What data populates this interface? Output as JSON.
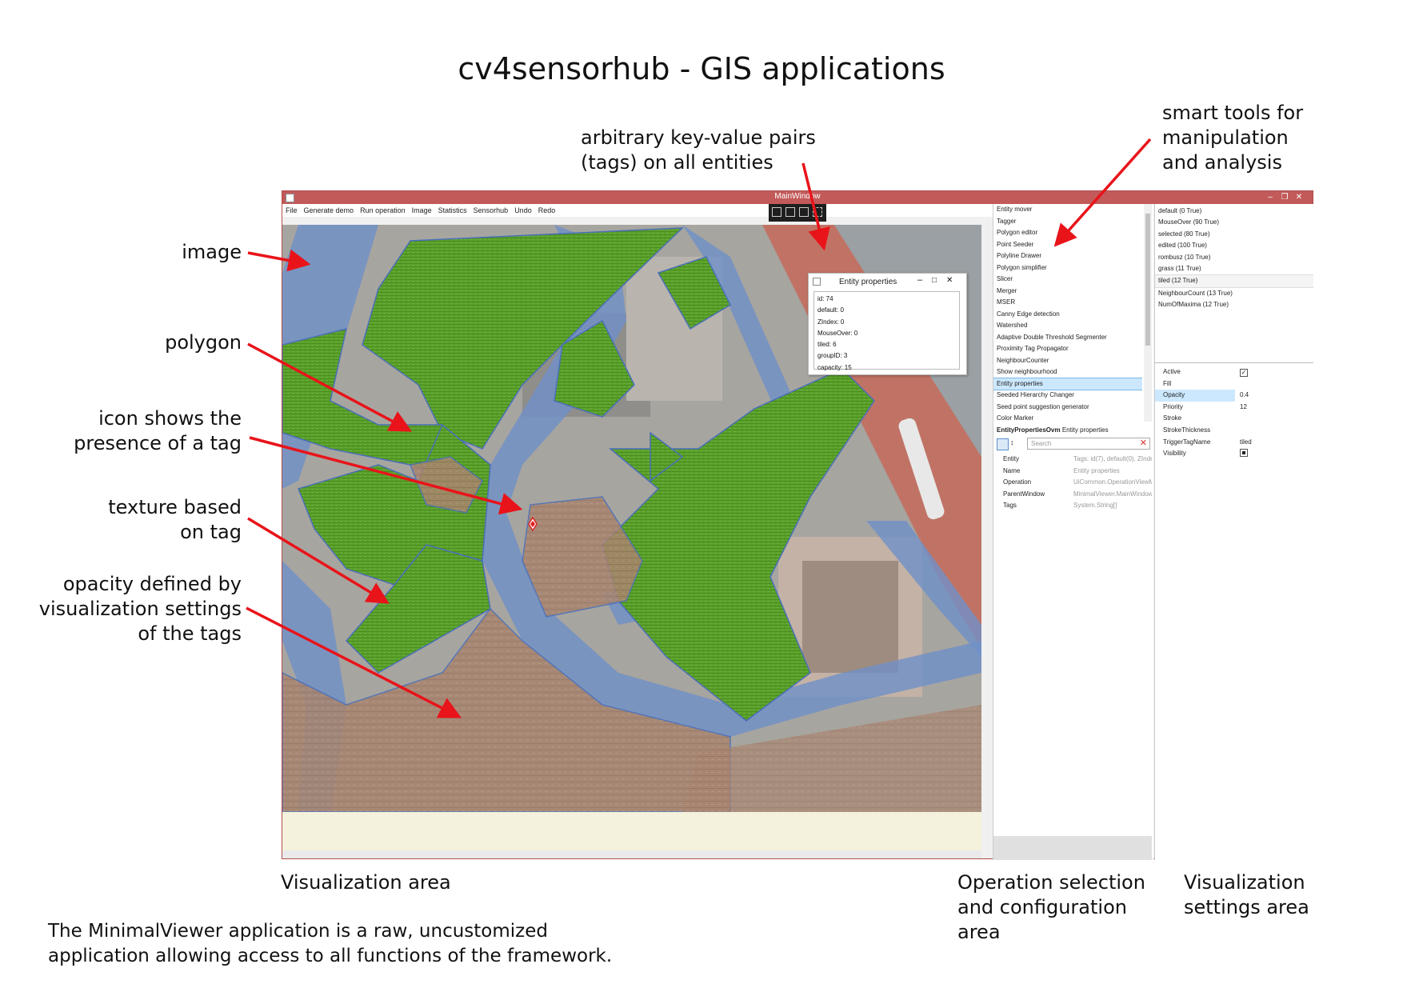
{
  "title": "cv4sensorhub - GIS applications",
  "annotations": {
    "image": "image",
    "polygon": "polygon",
    "icon_tag": [
      "icon shows the",
      "presence of a tag"
    ],
    "texture": [
      "texture based",
      "on tag"
    ],
    "opacity": [
      "opacity defined by",
      "visualization settings",
      "of the tags"
    ],
    "tags": [
      "arbitrary key-value pairs",
      "(tags) on all entities"
    ],
    "smart_tools": [
      "smart tools for",
      "manipulation",
      "and analysis"
    ]
  },
  "area_labels": {
    "visualization": "Visualization area",
    "operation": [
      "Operation selection",
      "and configuration",
      "area"
    ],
    "settings": [
      "Visualization",
      "settings area"
    ]
  },
  "footer": [
    "The MinimalViewer application is a raw, uncustomized",
    "application allowing access to all functions of the framework."
  ],
  "window": {
    "title": "MainWindow",
    "menu": [
      "File",
      "Generate demo",
      "Run operation",
      "Image",
      "Statistics",
      "Sensorhub",
      "Undo",
      "Redo"
    ]
  },
  "entity_popup": {
    "title": "Entity properties",
    "lines": [
      "id: 74",
      "default: 0",
      "ZIndex: 0",
      "MouseOver: 0",
      "tiled: 6",
      "groupID: 3",
      "capacity: 15"
    ]
  },
  "operations": {
    "items": [
      "Entity mover",
      "Tagger",
      "Polygon editor",
      "Point Seeder",
      "Polyline Drawer",
      "Polygon simplifier",
      "Slicer",
      "Merger",
      "MSER",
      "Canny Edge detection",
      "Watershed",
      "Adaptive Double Threshold Segmenter",
      "Proximity Tag Propagator",
      "NeighbourCounter",
      "Show neighbourhood",
      "Entity properties",
      "Seeded Hierarchy Changer",
      "Seed point suggestion generator",
      "Color Marker"
    ],
    "selected_index": 15,
    "props_header_bold": "EntityPropertiesOvm",
    "props_header_rest": "Entity properties",
    "search_placeholder": "Search",
    "props": [
      {
        "key": "Entity",
        "value": "Tags: id(7), default(0), ZInde"
      },
      {
        "key": "Name",
        "value": "Entity properties"
      },
      {
        "key": "Operation",
        "value": "UiCommon.OperationViewM"
      },
      {
        "key": "ParentWindow",
        "value": "MinimalViewer.MainWindow"
      },
      {
        "key": "Tags",
        "value": "System.String[]"
      }
    ]
  },
  "visualization": {
    "tags": [
      "default (0 True)",
      "MouseOver (90 True)",
      "selected (80 True)",
      "edited (100 True)",
      "rombusz (10 True)",
      "grass (11 True)",
      "tiled (12 True)",
      "NeighbourCount (13 True)",
      "NumOfMaxima (12 True)"
    ],
    "selected_tag_index": 6,
    "settings": [
      {
        "key": "Active",
        "value": ""
      },
      {
        "key": "Fill",
        "value": ""
      },
      {
        "key": "Opacity",
        "value": "0.4"
      },
      {
        "key": "Priority",
        "value": "12"
      },
      {
        "key": "Stroke",
        "value": ""
      },
      {
        "key": "StrokeThickness",
        "value": ""
      },
      {
        "key": "TriggerTagName",
        "value": "tiled"
      },
      {
        "key": "Visibility",
        "value": ""
      }
    ],
    "checkbox_active": true,
    "checkbox_visibility": true
  },
  "colors": {
    "titlebar": "#c25a5a",
    "road": "#6f90c8",
    "grass": "#5aa02a",
    "tiled": "#a8846e",
    "river": "#a3503f"
  }
}
